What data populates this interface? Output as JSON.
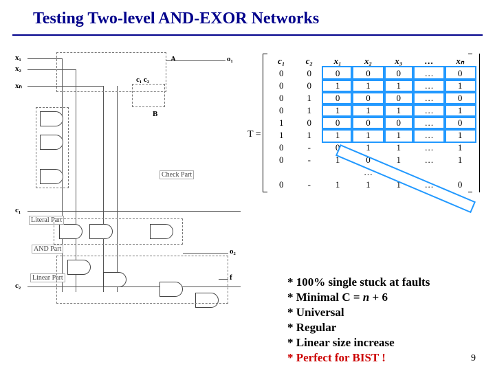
{
  "title": "Testing Two-level AND-EXOR Networks",
  "page_number": "9",
  "circuit_labels": {
    "x1": "x₁",
    "x2": "x₂",
    "xn": "xₙ",
    "c1": "c₁",
    "c2": "c₂",
    "A": "A",
    "B": "B",
    "c1c2": "c₁ c₂",
    "o1": "o₁",
    "o2": "o₂",
    "f": "f",
    "literal_part": "Literal Part",
    "and_part": "AND Part",
    "linear_part": "Linear Part",
    "check_part": "Check Part"
  },
  "matrix": {
    "T_label": "T =",
    "headers": [
      "c₁",
      "c₂",
      "x₁",
      "x₂",
      "x₃",
      "…",
      "xₙ"
    ],
    "rows": [
      [
        "0",
        "0",
        "0",
        "0",
        "0",
        "…",
        "0"
      ],
      [
        "0",
        "0",
        "1",
        "1",
        "1",
        "…",
        "1"
      ],
      [
        "0",
        "1",
        "0",
        "0",
        "0",
        "…",
        "0"
      ],
      [
        "0",
        "1",
        "1",
        "1",
        "1",
        "…",
        "1"
      ],
      [
        "1",
        "0",
        "0",
        "0",
        "0",
        "…",
        "0"
      ],
      [
        "1",
        "1",
        "1",
        "1",
        "1",
        "…",
        "1"
      ],
      [
        "0",
        "-",
        "0",
        "1",
        "1",
        "…",
        "1"
      ],
      [
        "0",
        "-",
        "1",
        "0",
        "1",
        "…",
        "1"
      ],
      [
        "",
        "",
        "",
        "…",
        "",
        "",
        ""
      ],
      [
        "0",
        "-",
        "1",
        "1",
        "1",
        "…",
        "0"
      ]
    ]
  },
  "bullets": {
    "b1": "* 100% single stuck at faults",
    "b2_pre": "* Minimal C = ",
    "b2_n": "n",
    "b2_post": " + 6",
    "b3": "* Universal",
    "b4": "* Regular",
    "b5": "* Linear size increase",
    "b6": "* Perfect for BIST !"
  }
}
